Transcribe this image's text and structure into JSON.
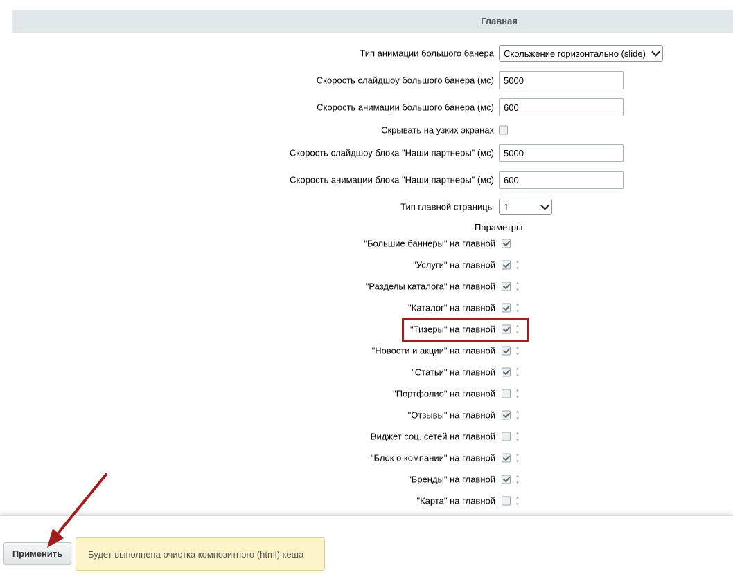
{
  "section": {
    "title": "Главная"
  },
  "fields": {
    "banner_animation_type": {
      "label": "Тип анимации большого банера",
      "value": "Скольжение горизонтально (slide)"
    },
    "banner_slideshow_speed": {
      "label": "Скорость слайдшоу большого банера (мс)",
      "value": "5000"
    },
    "banner_animation_speed": {
      "label": "Скорость анимации большого банера (мс)",
      "value": "600"
    },
    "hide_narrow": {
      "label": "Скрывать на узких экранах",
      "checked": false
    },
    "partners_slideshow_speed": {
      "label": "Скорость слайдшоу блока \"Наши партнеры\" (мс)",
      "value": "5000"
    },
    "partners_animation_speed": {
      "label": "Скорость анимации блока \"Наши партнеры\" (мс)",
      "value": "600"
    },
    "main_page_type": {
      "label": "Тип главной страницы",
      "value": "1"
    }
  },
  "params": {
    "title": "Параметры",
    "items": [
      {
        "label": "\"Большие баннеры\" на главной",
        "checked": true,
        "draggable": false
      },
      {
        "label": "\"Услуги\" на главной",
        "checked": true,
        "draggable": true
      },
      {
        "label": "\"Разделы каталога\" на главной",
        "checked": true,
        "draggable": true
      },
      {
        "label": "\"Каталог\" на главной",
        "checked": true,
        "draggable": true
      },
      {
        "label": "\"Тизеры\" на главной",
        "checked": true,
        "draggable": true
      },
      {
        "label": "\"Новости и акции\" на главной",
        "checked": true,
        "draggable": true
      },
      {
        "label": "\"Статьи\" на главной",
        "checked": true,
        "draggable": true
      },
      {
        "label": "\"Портфолио\" на главной",
        "checked": false,
        "draggable": true
      },
      {
        "label": "\"Отзывы\" на главной",
        "checked": true,
        "draggable": true
      },
      {
        "label": "Виджет соц. сетей на главной",
        "checked": false,
        "draggable": true
      },
      {
        "label": "\"Блок о компании\" на главной",
        "checked": true,
        "draggable": true
      },
      {
        "label": "\"Бренды\" на главной",
        "checked": true,
        "draggable": true
      },
      {
        "label": "\"Карта\" на главной",
        "checked": false,
        "draggable": true
      }
    ]
  },
  "footer": {
    "apply_label": "Применить",
    "notice": "Будет выполнена очистка композитного (html) кеша"
  },
  "colors": {
    "header_bg": "#e0e8ea",
    "highlight": "#a51c1c",
    "notice_bg": "#fdf5c9"
  }
}
